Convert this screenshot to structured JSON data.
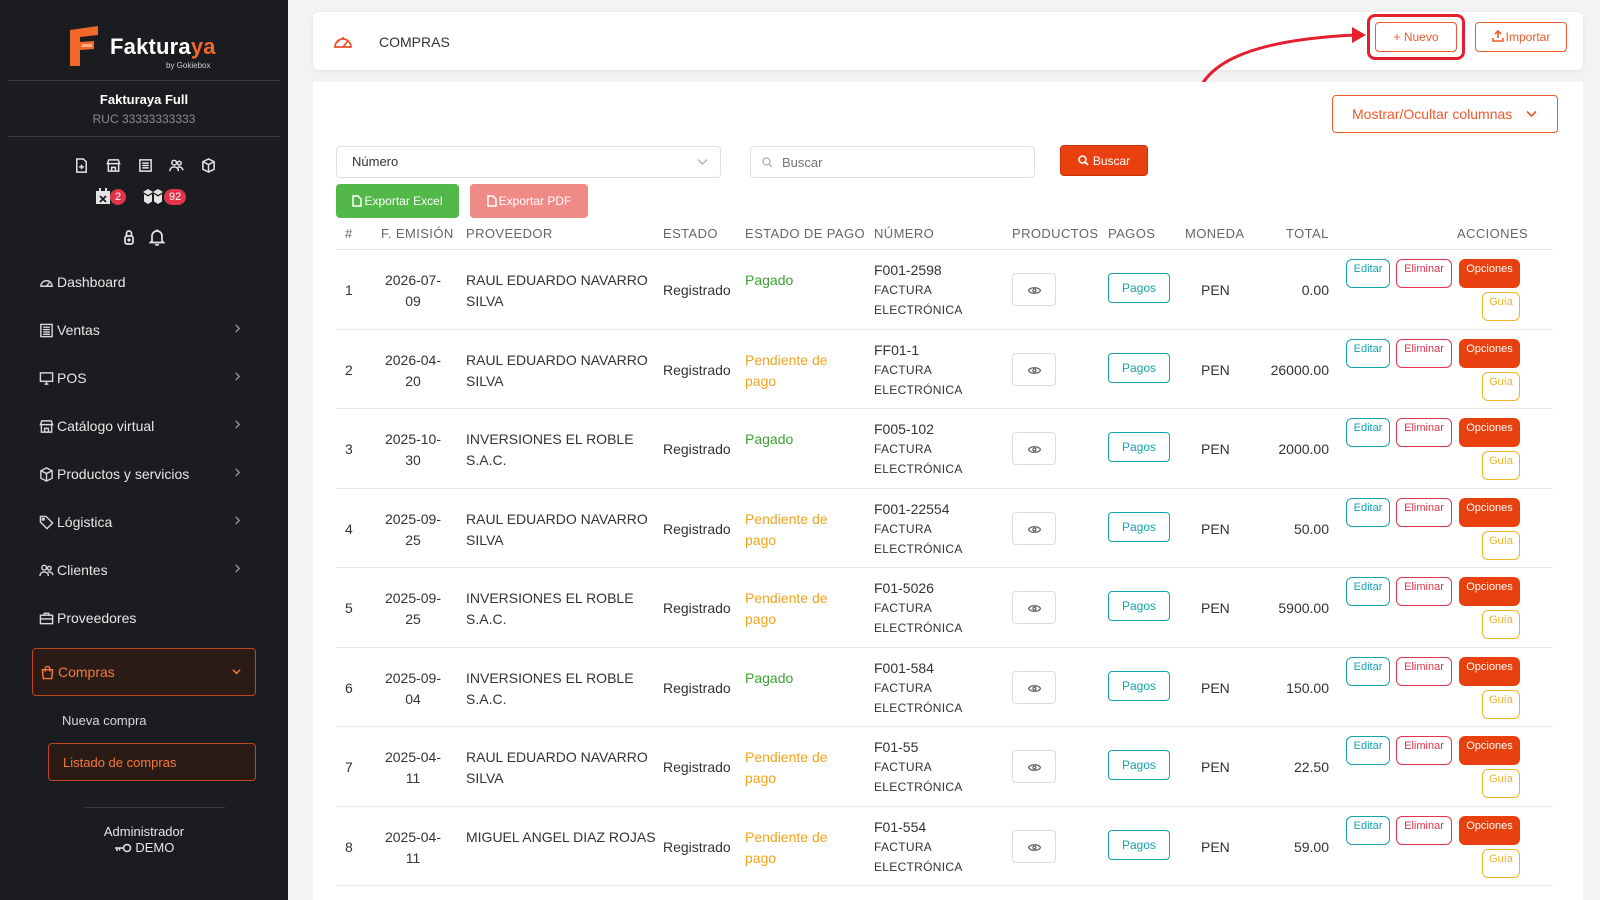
{
  "brand": {
    "name_main": "Faktura",
    "name_accent": "ya",
    "subtitle": "by Gokiebox",
    "accent_color": "#f2672a"
  },
  "company": {
    "name": "Fakturaya Full",
    "ruc": "RUC 33333333333"
  },
  "sidebar_badges": {
    "calendar_count": "2",
    "box_count": "92"
  },
  "nav": {
    "items": [
      {
        "label": "Dashboard",
        "icon": "gauge-icon"
      },
      {
        "label": "Ventas",
        "icon": "list-icon"
      },
      {
        "label": "POS",
        "icon": "monitor-icon"
      },
      {
        "label": "Catálogo virtual",
        "icon": "store-icon"
      },
      {
        "label": "Productos y servicios",
        "icon": "box-icon"
      },
      {
        "label": "Lógistica",
        "icon": "tag-icon"
      },
      {
        "label": "Clientes",
        "icon": "users-icon"
      },
      {
        "label": "Proveedores",
        "icon": "briefcase-icon"
      }
    ],
    "active": {
      "label": "Compras",
      "icon": "bag-icon"
    },
    "sub_items": [
      "Nueva compra",
      "Listado de compras"
    ]
  },
  "user": {
    "role": "Administrador",
    "name": "DEMO"
  },
  "header": {
    "title": "COMPRAS",
    "nuevo_label": "+ Nuevo",
    "importar_label": "Importar"
  },
  "toolbar": {
    "columns_label": "Mostrar/Ocultar columnas",
    "filter_selected": "Número",
    "search_placeholder": "Buscar",
    "search_button": "Buscar",
    "export_excel": "Exportar Excel",
    "export_pdf": "Exportar PDF"
  },
  "table": {
    "headers": [
      "#",
      "F. EMISIÓN",
      "PROVEEDOR",
      "ESTADO",
      "ESTADO DE PAGO",
      "NÚMERO",
      "PRODUCTOS",
      "PAGOS",
      "MONEDA",
      "TOTAL",
      "ACCIONES"
    ],
    "action_labels": {
      "pagos": "Pagos",
      "edit": "Editar",
      "delete": "Eliminar",
      "options": "Opciones",
      "guia": "Guía"
    },
    "rows": [
      {
        "idx": "1",
        "fecha": "2026-07-09",
        "proveedor": "RAUL EDUARDO NAVARRO SILVA",
        "estado": "Registrado",
        "pago": "Pagado",
        "numero": "F001-2598",
        "tipo1": "FACTURA",
        "tipo2": "ELECTRÓNICA",
        "moneda": "PEN",
        "total": "0.00"
      },
      {
        "idx": "2",
        "fecha": "2026-04-20",
        "proveedor": "RAUL EDUARDO NAVARRO SILVA",
        "estado": "Registrado",
        "pago": "Pendiente de pago",
        "numero": "FF01-1",
        "tipo1": "FACTURA",
        "tipo2": "ELECTRÓNICA",
        "moneda": "PEN",
        "total": "26000.00"
      },
      {
        "idx": "3",
        "fecha": "2025-10-30",
        "proveedor": "INVERSIONES EL ROBLE S.A.C.",
        "estado": "Registrado",
        "pago": "Pagado",
        "numero": "F005-102",
        "tipo1": "FACTURA",
        "tipo2": "ELECTRÓNICA",
        "moneda": "PEN",
        "total": "2000.00"
      },
      {
        "idx": "4",
        "fecha": "2025-09-25",
        "proveedor": "RAUL EDUARDO NAVARRO SILVA",
        "estado": "Registrado",
        "pago": "Pendiente de pago",
        "numero": "F001-22554",
        "tipo1": "FACTURA",
        "tipo2": "ELECTRÓNICA",
        "moneda": "PEN",
        "total": "50.00"
      },
      {
        "idx": "5",
        "fecha": "2025-09-25",
        "proveedor": "INVERSIONES EL ROBLE S.A.C.",
        "estado": "Registrado",
        "pago": "Pendiente de pago",
        "numero": "F01-5026",
        "tipo1": "FACTURA",
        "tipo2": "ELECTRÓNICA",
        "moneda": "PEN",
        "total": "5900.00"
      },
      {
        "idx": "6",
        "fecha": "2025-09-04",
        "proveedor": "INVERSIONES EL ROBLE S.A.C.",
        "estado": "Registrado",
        "pago": "Pagado",
        "numero": "F001-584",
        "tipo1": "FACTURA",
        "tipo2": "ELECTRÓNICA",
        "moneda": "PEN",
        "total": "150.00"
      },
      {
        "idx": "7",
        "fecha": "2025-04-11",
        "proveedor": "RAUL EDUARDO NAVARRO SILVA",
        "estado": "Registrado",
        "pago": "Pendiente de pago",
        "numero": "F01-55",
        "tipo1": "FACTURA",
        "tipo2": "ELECTRÓNICA",
        "moneda": "PEN",
        "total": "22.50"
      },
      {
        "idx": "8",
        "fecha": "2025-04-11",
        "proveedor": "MIGUEL ANGEL DIAZ ROJAS",
        "estado": "Registrado",
        "pago": "Pendiente de pago",
        "numero": "F01-554",
        "tipo1": "FACTURA",
        "tipo2": "ELECTRÓNICA",
        "moneda": "PEN",
        "total": "59.00"
      }
    ]
  }
}
